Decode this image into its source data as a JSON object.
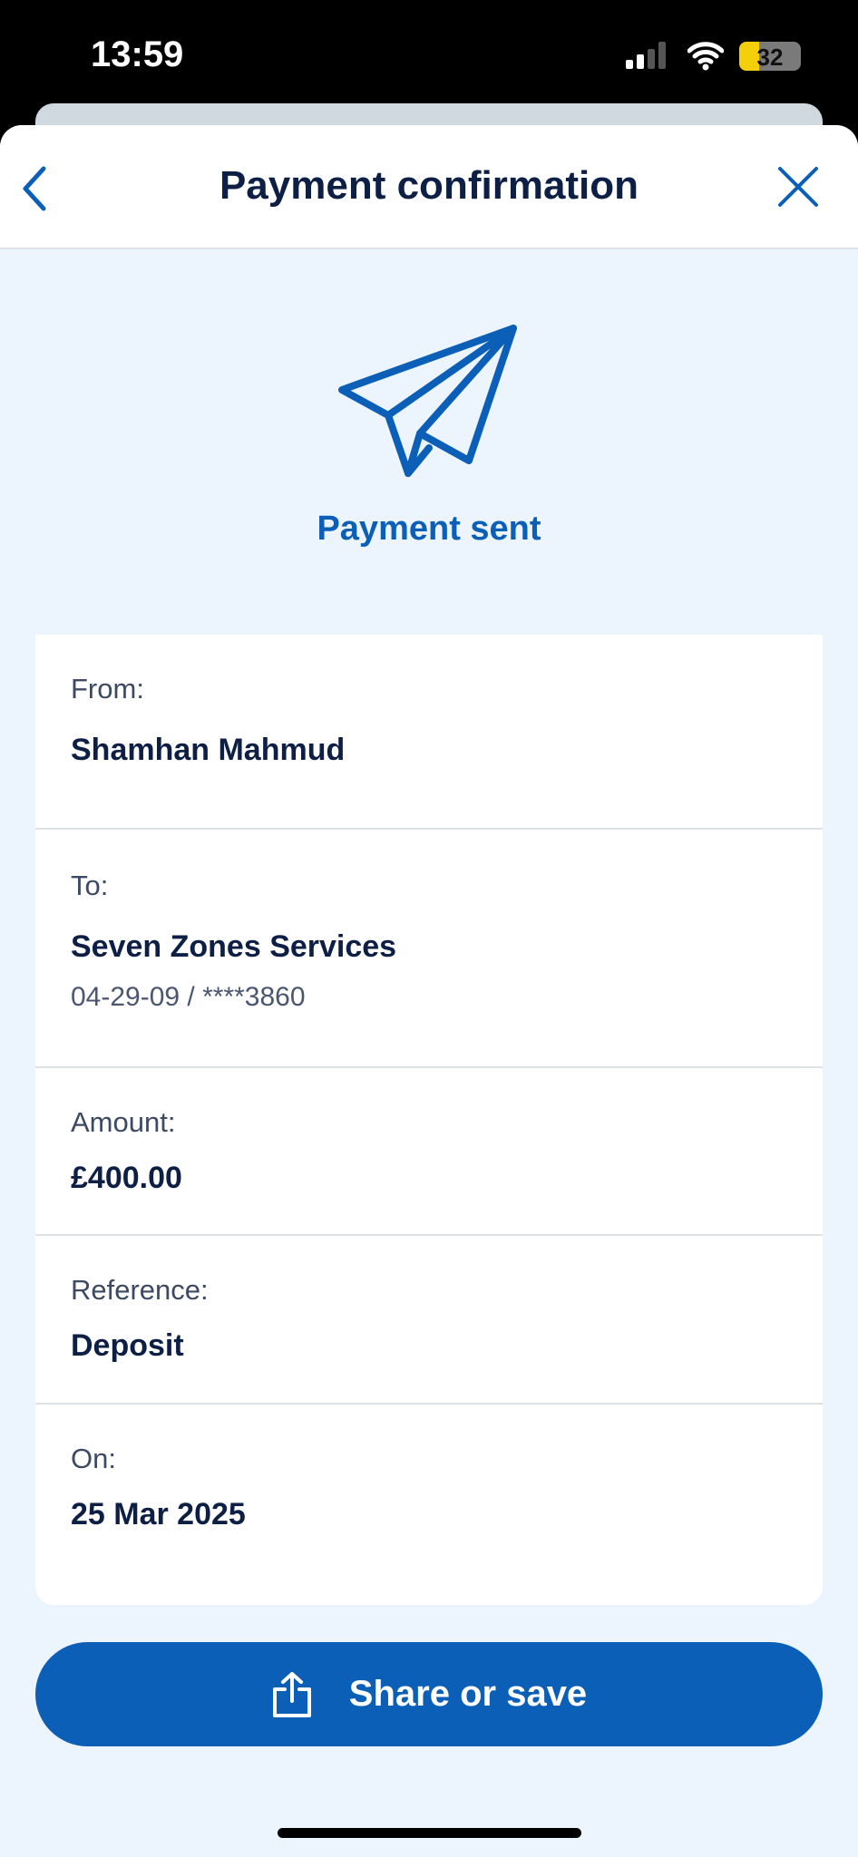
{
  "status_bar": {
    "time": "13:59",
    "battery": "32",
    "signal_bars": 2
  },
  "header": {
    "title": "Payment confirmation",
    "back_icon": "chevron-left-icon",
    "close_icon": "close-icon"
  },
  "hero": {
    "icon": "paper-plane-icon",
    "text": "Payment sent"
  },
  "details": [
    {
      "label": "From:",
      "value": "Shamhan Mahmud"
    },
    {
      "label": "To:",
      "value": "Seven Zones Services",
      "sub": "04-29-09 / ****3860"
    },
    {
      "label": "Amount:",
      "value": "£400.00"
    },
    {
      "label": "Reference:",
      "value": "Deposit"
    },
    {
      "label": "On:",
      "value": "25 Mar 2025"
    }
  ],
  "share_button": {
    "label": "Share or save",
    "icon": "share-icon"
  },
  "colors": {
    "accent": "#0b5fb7",
    "text": "#0e1f45",
    "background": "#ecf4fd"
  }
}
